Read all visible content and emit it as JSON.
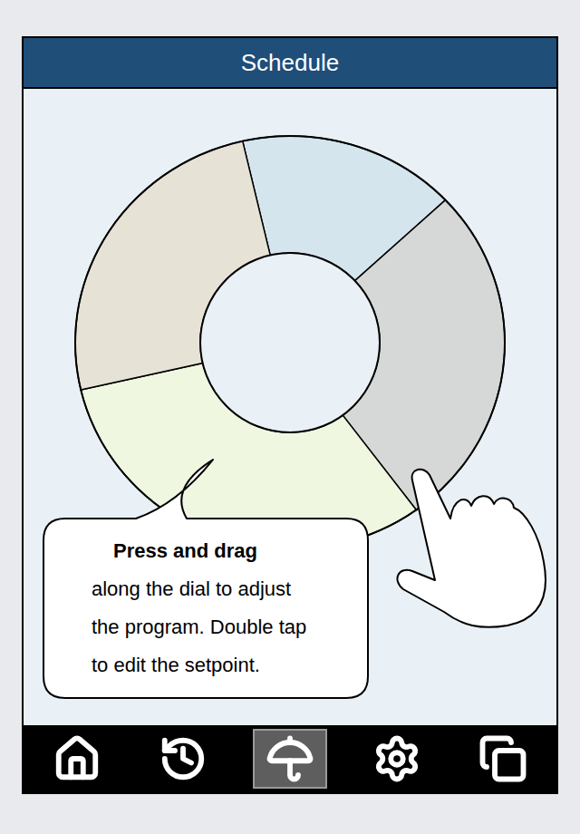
{
  "header": {
    "title": "Schedule"
  },
  "dial": {
    "segments": [
      {
        "start_hour": 23.15,
        "end_hour": 3.09,
        "color": "#d5e5ee"
      },
      {
        "start_hour": 3.09,
        "end_hour": 9.6,
        "color": "#d6d7d7"
      },
      {
        "start_hour": 9.6,
        "end_hour": 17.12,
        "color": "#f0f7e1"
      },
      {
        "start_hour": 17.12,
        "end_hour": 23.15,
        "color": "#e7e2d6"
      }
    ]
  },
  "hint": {
    "lines": [
      "Press and drag",
      "along the dial to adjust",
      "the program. Double tap",
      "to edit the setpoint."
    ]
  },
  "nav": {
    "items": [
      {
        "selected": false
      },
      {
        "selected": false
      },
      {
        "selected": true
      },
      {
        "selected": false
      },
      {
        "selected": false
      }
    ]
  }
}
